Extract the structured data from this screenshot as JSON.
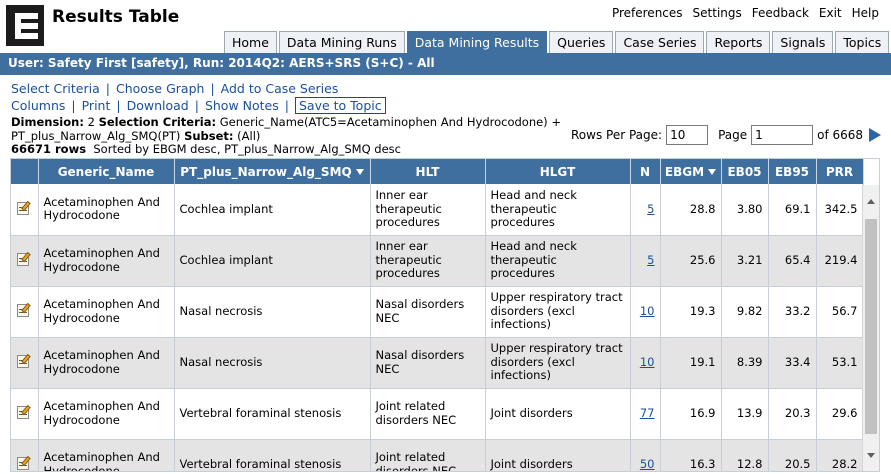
{
  "header": {
    "app_title": "Results Table",
    "top_links": [
      "Preferences",
      "Settings",
      "Feedback",
      "Exit",
      "Help"
    ]
  },
  "tabs": [
    {
      "label": "Home",
      "active": false
    },
    {
      "label": "Data Mining Runs",
      "active": false
    },
    {
      "label": "Data Mining Results",
      "active": true
    },
    {
      "label": "Queries",
      "active": false
    },
    {
      "label": "Case Series",
      "active": false
    },
    {
      "label": "Reports",
      "active": false
    },
    {
      "label": "Signals",
      "active": false
    },
    {
      "label": "Topics",
      "active": false
    }
  ],
  "userbar": "User: Safety First [safety],  Run: 2014Q2: AERS+SRS (S+C) - All",
  "actions_row1": [
    "Select Criteria",
    "Choose Graph",
    "Add to Case Series"
  ],
  "actions_row2": [
    "Columns",
    "Print",
    "Download",
    "Show Notes",
    "Save to Topic"
  ],
  "info": {
    "dimension_label": "Dimension:",
    "dimension_value": "2",
    "criteria_label": "Selection Criteria:",
    "criteria_value": "Generic_Name(ATC5=Acetaminophen And Hydrocodone) + PT_plus_Narrow_Alg_SMQ(PT)",
    "subset_label": "Subset:",
    "subset_value": "(All)",
    "rows_count": "66671 rows",
    "sorted_by": "Sorted by EBGM desc, PT_plus_Narrow_Alg_SMQ desc"
  },
  "pager": {
    "rows_per_page_label": "Rows Per Page:",
    "rows_per_page_value": "10",
    "page_label": "Page",
    "page_value": "1",
    "of_label": "of 6668"
  },
  "columns": [
    "",
    "Generic_Name",
    "PT_plus_Narrow_Alg_SMQ",
    "HLT",
    "HLGT",
    "N",
    "EBGM",
    "EB05",
    "EB95",
    "PRR"
  ],
  "rows": [
    {
      "generic": "Acetaminophen And Hydrocodone",
      "pt": "Cochlea implant",
      "hlt": "Inner ear therapeutic procedures",
      "hlgt": "Head and neck therapeutic procedures",
      "n": "5",
      "ebgm": "28.8",
      "eb05": "3.80",
      "eb95": "69.1",
      "prr": "342.5"
    },
    {
      "generic": "Acetaminophen And Hydrocodone",
      "pt": "Cochlea implant",
      "hlt": "Inner ear therapeutic procedures",
      "hlgt": "Head and neck therapeutic procedures",
      "n": "5",
      "ebgm": "25.6",
      "eb05": "3.21",
      "eb95": "65.4",
      "prr": "219.4"
    },
    {
      "generic": "Acetaminophen And Hydrocodone",
      "pt": "Nasal necrosis",
      "hlt": "Nasal disorders NEC",
      "hlgt": "Upper respiratory tract disorders (excl infections)",
      "n": "10",
      "ebgm": "19.3",
      "eb05": "9.82",
      "eb95": "33.2",
      "prr": "56.7"
    },
    {
      "generic": "Acetaminophen And Hydrocodone",
      "pt": "Nasal necrosis",
      "hlt": "Nasal disorders NEC",
      "hlgt": "Upper respiratory tract disorders (excl infections)",
      "n": "10",
      "ebgm": "19.1",
      "eb05": "8.39",
      "eb95": "33.4",
      "prr": "53.1"
    },
    {
      "generic": "Acetaminophen And Hydrocodone",
      "pt": "Vertebral foraminal stenosis",
      "hlt": "Joint related disorders NEC",
      "hlgt": "Joint disorders",
      "n": "77",
      "ebgm": "16.9",
      "eb05": "13.9",
      "eb95": "20.3",
      "prr": "29.6"
    },
    {
      "generic": "Acetaminophen And Hydrocodone",
      "pt": "Vertebral foraminal stenosis",
      "hlt": "Joint related disorders NEC",
      "hlgt": "Joint disorders",
      "n": "50",
      "ebgm": "16.3",
      "eb05": "12.8",
      "eb95": "20.5",
      "prr": "28.2"
    }
  ],
  "colors": {
    "accent": "#3f6f9f",
    "link": "#1a4f9c",
    "alt_row": "#e4e4e4"
  }
}
